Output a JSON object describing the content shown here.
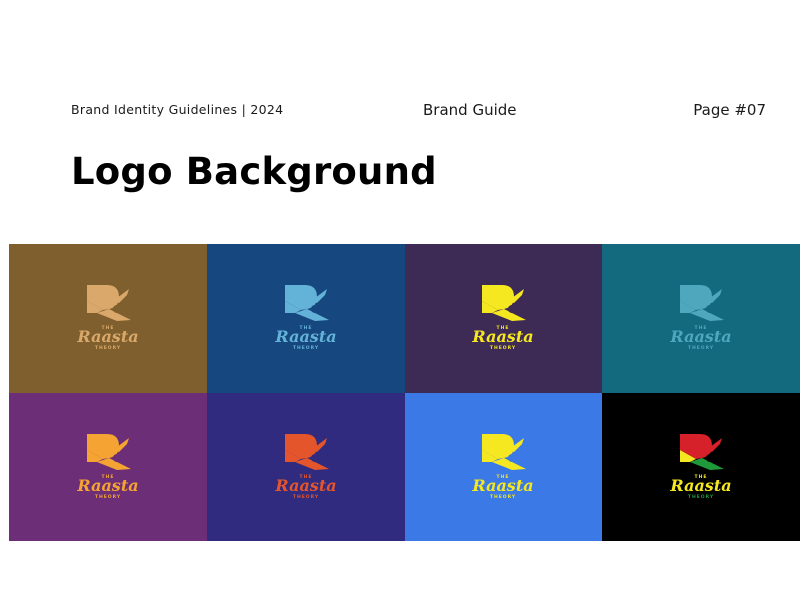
{
  "header": {
    "left": "Brand Identity Guidelines | 2024",
    "center": "Brand Guide",
    "right": "Page #07"
  },
  "title": "Logo Background",
  "logo": {
    "top": "THE",
    "name": "Raasta",
    "bottom": "THEORY"
  },
  "tiles": [
    {
      "bg": "#7e5f2d",
      "logo": "#d9a86a",
      "icon": "logo-icon"
    },
    {
      "bg": "#16477f",
      "logo": "#63b2d8",
      "icon": "logo-icon"
    },
    {
      "bg": "#3d2a55",
      "logo": "#f6e820",
      "icon": "logo-icon"
    },
    {
      "bg": "#136a7f",
      "logo": "#4ea7bd",
      "icon": "logo-icon"
    },
    {
      "bg": "#6b2e77",
      "logo": "#f5a433",
      "icon": "logo-icon"
    },
    {
      "bg": "#302b7e",
      "logo": "#e5552c",
      "icon": "logo-icon"
    },
    {
      "bg": "#3a79e6",
      "logo": "#f6e820",
      "icon": "logo-icon"
    },
    {
      "bg": "#000000",
      "logo": "#f6e820",
      "icon": "logo-icon",
      "multicolor": true
    }
  ]
}
